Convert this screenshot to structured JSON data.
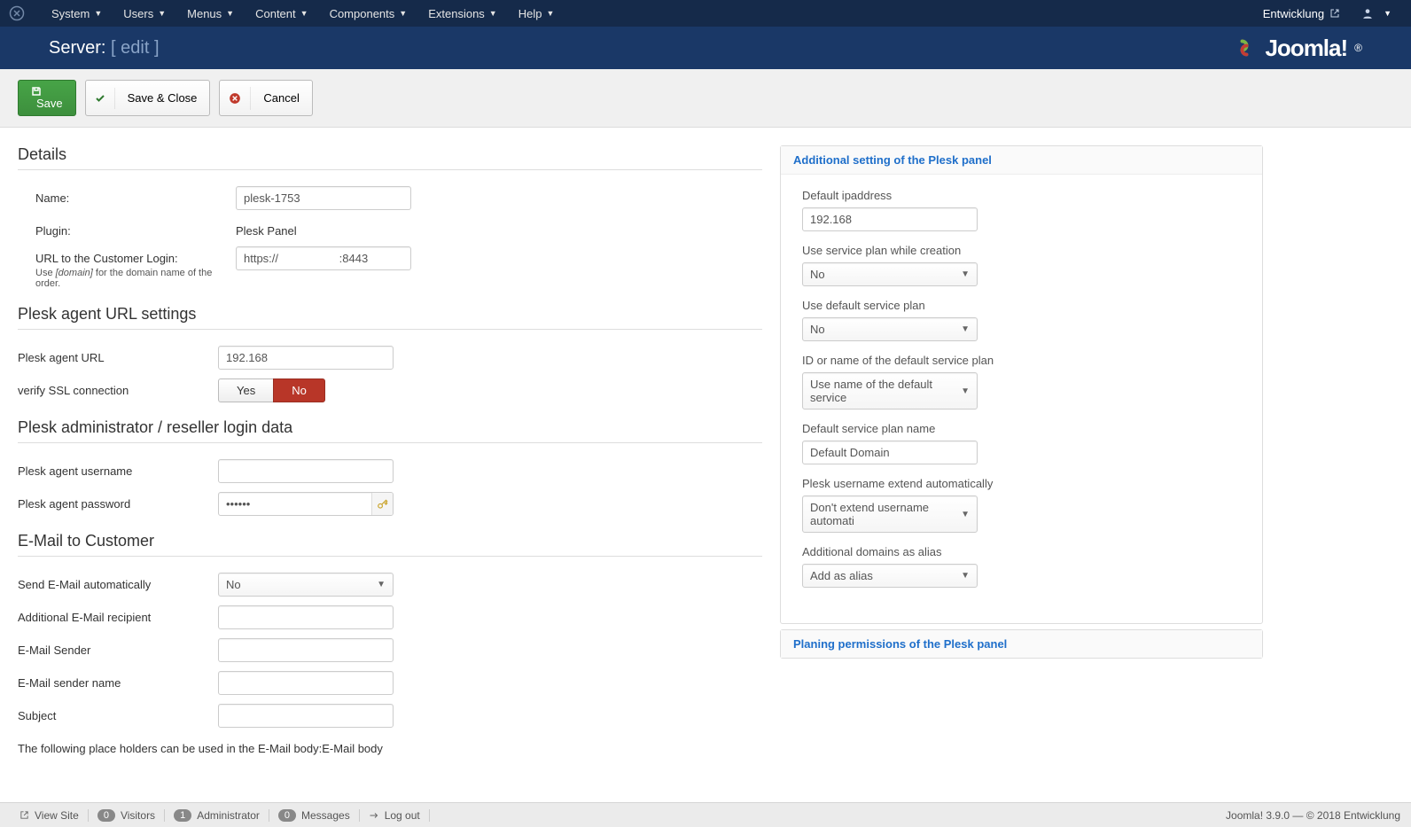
{
  "navbar": {
    "items": [
      "System",
      "Users",
      "Menus",
      "Content",
      "Components",
      "Extensions",
      "Help"
    ],
    "site_name": "Entwicklung"
  },
  "header": {
    "title_prefix": "Server:",
    "title_edit": "[ edit ]",
    "logo_text": "Joomla!"
  },
  "toolbar": {
    "save": "Save",
    "save_close": "Save & Close",
    "cancel": "Cancel"
  },
  "sections": {
    "details": "Details",
    "plesk_url": "Plesk agent URL settings",
    "plesk_login": "Plesk administrator / reseller login data",
    "email": "E-Mail to Customer"
  },
  "details": {
    "name_label": "Name:",
    "name_value": "plesk-1753",
    "plugin_label": "Plugin:",
    "plugin_value": "Plesk Panel",
    "url_label": "URL to the Customer Login:",
    "url_hint_pre": "Use ",
    "url_hint_em": "[domain]",
    "url_hint_post": " for the domain name of the order.",
    "url_value": "https://                   :8443"
  },
  "plesk_url": {
    "agent_url_label": "Plesk agent URL",
    "agent_url_value": "192.168",
    "ssl_label": "verify SSL connection",
    "ssl_yes": "Yes",
    "ssl_no": "No"
  },
  "plesk_login": {
    "username_label": "Plesk agent username",
    "username_value": "",
    "password_label": "Plesk agent password",
    "password_value": "••••••"
  },
  "email": {
    "send_auto_label": "Send E-Mail automatically",
    "send_auto_value": "No",
    "add_recipient_label": "Additional E-Mail recipient",
    "sender_label": "E-Mail Sender",
    "sender_name_label": "E-Mail sender name",
    "subject_label": "Subject",
    "placeholders_note": "The following place holders can be used in the E-Mail body:E-Mail body"
  },
  "sidebar": {
    "acc1_title": "Additional setting of the Plesk panel",
    "acc2_title": "Planing permissions of the Plesk panel",
    "fields": {
      "default_ip_label": "Default ipaddress",
      "default_ip_value": "192.168",
      "use_plan_label": "Use service plan while creation",
      "use_plan_value": "No",
      "use_default_plan_label": "Use default service plan",
      "use_default_plan_value": "No",
      "id_name_label": "ID or name of the default service plan",
      "id_name_value": "Use name of the default service",
      "default_plan_name_label": "Default service plan name",
      "default_plan_name_value": "Default Domain",
      "user_extend_label": "Plesk username extend automatically",
      "user_extend_value": "Don't extend username automati",
      "add_domains_label": "Additional domains as alias",
      "add_domains_value": "Add as alias"
    }
  },
  "footer": {
    "view_site": "View Site",
    "visitors_count": "0",
    "visitors": "Visitors",
    "admin_count": "1",
    "admin": "Administrator",
    "msg_count": "0",
    "messages": "Messages",
    "logout": "Log out",
    "right": "Joomla! 3.9.0  —  © 2018 Entwicklung"
  }
}
